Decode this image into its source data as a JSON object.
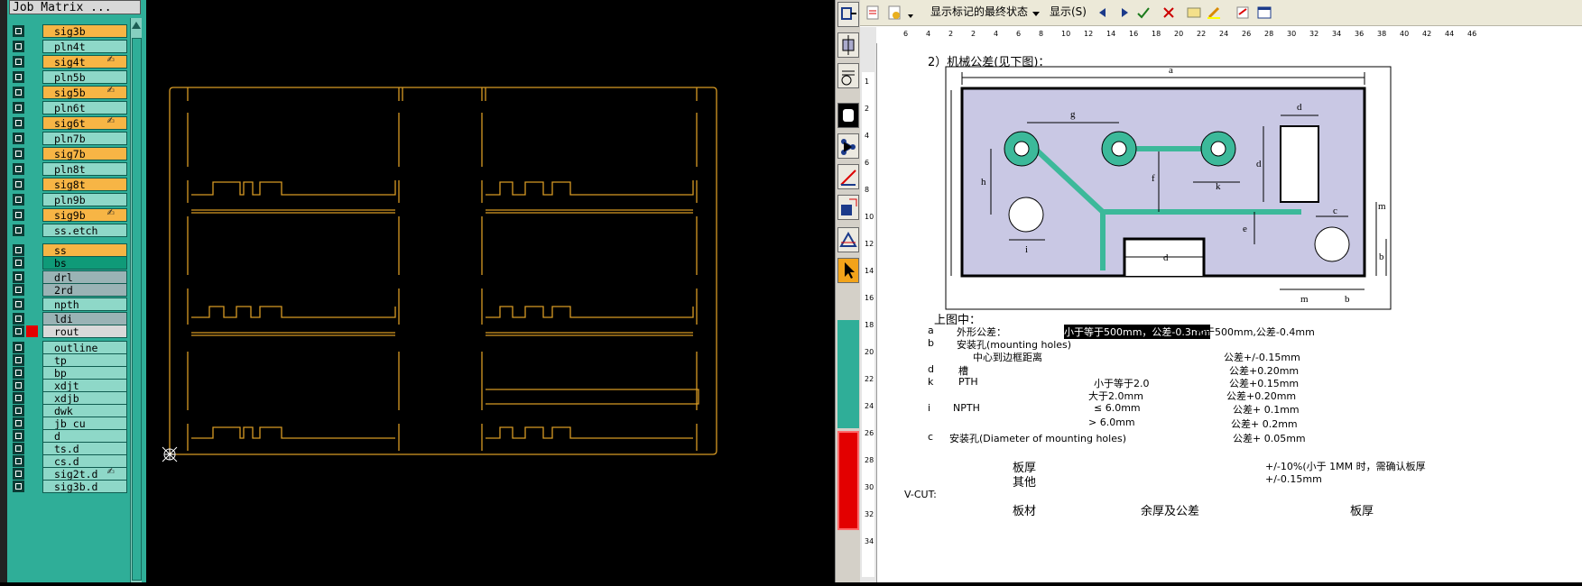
{
  "layer_panel": {
    "title": "Job Matrix ...",
    "layers": [
      {
        "name": "sig3b",
        "color": "#f7b545",
        "marked": false
      },
      {
        "name": "pln4t",
        "color": "#8ed8c8",
        "marked": false
      },
      {
        "name": "sig4t",
        "color": "#f7b545",
        "marked": true
      },
      {
        "name": "pln5b",
        "color": "#8ed8c8",
        "marked": false
      },
      {
        "name": "sig5b",
        "color": "#f7b545",
        "marked": true
      },
      {
        "name": "pln6t",
        "color": "#8ed8c8",
        "marked": false
      },
      {
        "name": "sig6t",
        "color": "#f7b545",
        "marked": true
      },
      {
        "name": "pln7b",
        "color": "#8ed8c8",
        "marked": false
      },
      {
        "name": "sig7b",
        "color": "#f7b545",
        "marked": false
      },
      {
        "name": "pln8t",
        "color": "#8ed8c8",
        "marked": false
      },
      {
        "name": "sig8t",
        "color": "#f7b545",
        "marked": false
      },
      {
        "name": "pln9b",
        "color": "#8ed8c8",
        "marked": false
      },
      {
        "name": "sig9b",
        "color": "#f7b545",
        "marked": true
      },
      {
        "name": "ss.etch",
        "color": "#8ed8c8",
        "marked": false
      },
      {
        "name": "ss",
        "color": "#f7b545",
        "marked": false
      },
      {
        "name": "bs",
        "color": "#0f9a78",
        "marked": false
      },
      {
        "name": "drl",
        "color": "#9ab3b5",
        "marked": false
      },
      {
        "name": "2rd",
        "color": "#9ab3b5",
        "marked": false
      },
      {
        "name": "npth",
        "color": "#8ed8c8",
        "marked": false
      },
      {
        "name": "ldi",
        "color": "#9ab3b5",
        "marked": false
      },
      {
        "name": "rout",
        "color": "#d9d9d9",
        "marked": false,
        "active": true
      },
      {
        "name": "outline",
        "color": "#8ed8c8",
        "marked": false
      },
      {
        "name": "tp",
        "color": "#8ed8c8",
        "marked": false
      },
      {
        "name": "bp",
        "color": "#8ed8c8",
        "marked": false
      },
      {
        "name": "xdjt",
        "color": "#8ed8c8",
        "marked": false
      },
      {
        "name": "xdjb",
        "color": "#8ed8c8",
        "marked": false
      },
      {
        "name": "dwk",
        "color": "#8ed8c8",
        "marked": false
      },
      {
        "name": "jb_cu",
        "color": "#8ed8c8",
        "marked": false
      },
      {
        "name": "d",
        "color": "#8ed8c8",
        "marked": false
      },
      {
        "name": "ts.d",
        "color": "#8ed8c8",
        "marked": false
      },
      {
        "name": "cs.d",
        "color": "#8ed8c8",
        "marked": false
      },
      {
        "name": "sig2t.d",
        "color": "#8ed8c8",
        "marked": true
      },
      {
        "name": "sig3b.d",
        "color": "#8ed8c8",
        "marked": false
      }
    ]
  },
  "colors": {
    "panel": "#2fae98",
    "board_outline": "#d79a24",
    "figure_fill": "#c9c8e4",
    "trace": "#3cb99a"
  },
  "word": {
    "toolbar": {
      "markup_view": "显示标记的最终状态",
      "show_button": "显示(S)"
    },
    "hruler_ticks": [
      "6",
      "4",
      "2",
      "2",
      "4",
      "6",
      "8",
      "10",
      "12",
      "14",
      "16",
      "18",
      "20",
      "22",
      "24",
      "26",
      "28",
      "30",
      "32",
      "34",
      "36",
      "38",
      "40",
      "42",
      "44",
      "46"
    ],
    "vruler_ticks": [
      "1",
      "2",
      "4",
      "6",
      "8",
      "10",
      "12",
      "14",
      "16",
      "18",
      "20",
      "22",
      "24",
      "26",
      "28",
      "30",
      "32",
      "34"
    ],
    "heading": "2）机械公差(见下图)：",
    "figure_labels": {
      "a": "a",
      "g": "g",
      "d": "d",
      "h": "h",
      "f": "f",
      "k": "k",
      "i": "i",
      "e": "e",
      "c": "c",
      "m": "m",
      "b": "b"
    },
    "caption": "上图中：",
    "tolerances": [
      {
        "key": "a",
        "label": "外形公差：",
        "cond1": "小于等于500mm，公差-0.3mm",
        "cond2": "大于500mm,公差-0.4mm"
      },
      {
        "key": "b",
        "label": "安装孔(mounting holes)"
      },
      {
        "key": "",
        "label": "中心到边框距离",
        "tol": "公差+/-0.15mm"
      },
      {
        "key": "d",
        "label": "槽",
        "tol": "公差+0.20mm"
      },
      {
        "key": "k",
        "label": "PTH",
        "cond": "小于等于2.0",
        "tol": "公差+0.15mm"
      },
      {
        "key": "",
        "cond": "大于2.0mm",
        "tol": "公差+0.20mm"
      },
      {
        "key": "i",
        "label": "NPTH",
        "cond": "≤ 6.0mm",
        "tol": "公差+ 0.1mm"
      },
      {
        "key": "",
        "cond": "> 6.0mm",
        "tol": "公差+ 0.2mm"
      },
      {
        "key": "c",
        "label": "安装孔(Diameter of mounting holes)",
        "tol": "公差+ 0.05mm"
      }
    ],
    "thickness_label": "板厚",
    "thickness_tol": "+/-10%(小于 1MM 时，需确认板厚",
    "other_label": "其他",
    "other_tol": "+/-0.15mm",
    "vcut": "V-CUT:",
    "vcut_headers": [
      "板材",
      "余厚及公差",
      "板厚"
    ]
  }
}
